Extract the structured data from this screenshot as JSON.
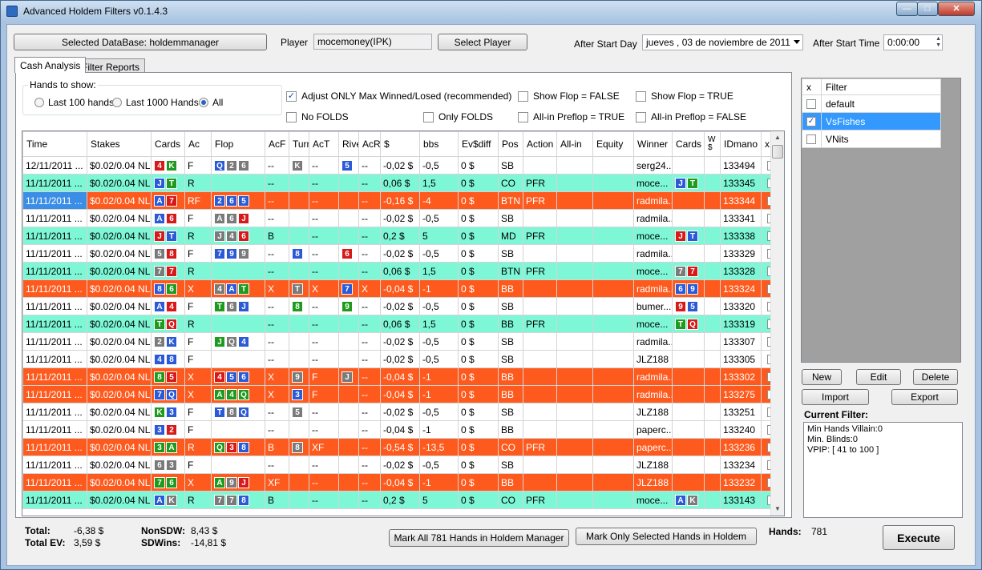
{
  "window": {
    "title": "Advanced Holdem Filters v0.1.4.3"
  },
  "top": {
    "db_button": "Selected DataBase: holdemmanager",
    "player_label": "Player",
    "player_value": "mocemoney(IPK)",
    "select_player": "Select Player",
    "after_start_day_label": "After Start Day",
    "after_start_day_value": "jueves  , 03 de noviembre de 2011",
    "after_start_time_label": "After Start Time",
    "after_start_time_value": "0:00:00"
  },
  "tabs": [
    {
      "label": "Cash Analysis"
    },
    {
      "label": "Filter Reports"
    }
  ],
  "hands_group": {
    "title": "Hands to show:",
    "options": [
      "Last 100 hands",
      "Last 1000 Hands",
      "All"
    ],
    "selected": "All"
  },
  "options": {
    "adjust": "Adjust ONLY Max Winned/Losed (recommended)",
    "no_folds": "No FOLDS",
    "only_folds": "Only FOLDS",
    "show_flop_false": "Show Flop = FALSE",
    "show_flop_true": "Show Flop = TRUE",
    "allin_true": "All-in Preflop = TRUE",
    "allin_false": "All-in Preflop = FALSE"
  },
  "grid": {
    "columns": [
      "Time",
      "Stakes",
      "Cards",
      "Ac",
      "Flop",
      "AcF",
      "Turn",
      "AcT",
      "Rive",
      "AcR",
      "$",
      "bbs",
      "Ev$diff",
      "Pos",
      "Action",
      "All-in",
      "Equity",
      "Winner",
      "Cards",
      "W $",
      "IDmano",
      "x"
    ],
    "rows": [
      {
        "c": "white",
        "time": "12/11/2011 ...",
        "stakes": "$0.02/0.04 NL",
        "cards": [
          [
            "4",
            "r"
          ],
          [
            "K",
            "g"
          ]
        ],
        "ac": "F",
        "flop": [
          [
            "Q",
            "b"
          ],
          [
            "2",
            "k"
          ],
          [
            "6",
            "k"
          ]
        ],
        "acf": "--",
        "turn": [
          [
            "K",
            "k"
          ]
        ],
        "act": "--",
        "river": [
          [
            "5",
            "b"
          ]
        ],
        "acr": "--",
        "usd": "-0,02 $",
        "bbs": "-0,5",
        "ev": "0 $",
        "pos": "SB",
        "action": "",
        "allin": "",
        "equity": "",
        "winner": "serg24...",
        "wcards": [],
        "wd": "",
        "id": "133494"
      },
      {
        "c": "green",
        "time": "11/11/2011 ...",
        "stakes": "$0.02/0.04 NL",
        "cards": [
          [
            "J",
            "b"
          ],
          [
            "T",
            "g"
          ]
        ],
        "ac": "R",
        "flop": [],
        "acf": "--",
        "turn": [],
        "act": "--",
        "river": [],
        "acr": "--",
        "usd": "0,06 $",
        "bbs": "1,5",
        "ev": "0 $",
        "pos": "CO",
        "action": "PFR",
        "allin": "",
        "equity": "",
        "winner": "moce...",
        "wcards": [
          [
            "J",
            "b"
          ],
          [
            "T",
            "g"
          ]
        ],
        "wd": "",
        "id": "133345"
      },
      {
        "c": "red",
        "sel": true,
        "time": "11/11/2011 ...",
        "stakes": "$0.02/0.04 NL",
        "cards": [
          [
            "A",
            "b"
          ],
          [
            "7",
            "r"
          ]
        ],
        "ac": "RF",
        "flop": [
          [
            "2",
            "b"
          ],
          [
            "6",
            "b"
          ],
          [
            "5",
            "b"
          ]
        ],
        "acf": "--",
        "turn": [],
        "act": "--",
        "river": [],
        "acr": "--",
        "usd": "-0,16 $",
        "bbs": "-4",
        "ev": "0 $",
        "pos": "BTN",
        "action": "PFR",
        "allin": "",
        "equity": "",
        "winner": "radmila...",
        "wcards": [],
        "wd": "",
        "id": "133344"
      },
      {
        "c": "white",
        "time": "11/11/2011 ...",
        "stakes": "$0.02/0.04 NL",
        "cards": [
          [
            "A",
            "b"
          ],
          [
            "6",
            "r"
          ]
        ],
        "ac": "F",
        "flop": [
          [
            "A",
            "k"
          ],
          [
            "6",
            "k"
          ],
          [
            "J",
            "r"
          ]
        ],
        "acf": "--",
        "turn": [],
        "act": "--",
        "river": [],
        "acr": "--",
        "usd": "-0,02 $",
        "bbs": "-0,5",
        "ev": "0 $",
        "pos": "SB",
        "action": "",
        "allin": "",
        "equity": "",
        "winner": "radmila...",
        "wcards": [],
        "wd": "",
        "id": "133341"
      },
      {
        "c": "green",
        "time": "11/11/2011 ...",
        "stakes": "$0.02/0.04 NL",
        "cards": [
          [
            "J",
            "r"
          ],
          [
            "T",
            "b"
          ]
        ],
        "ac": "R",
        "flop": [
          [
            "J",
            "k"
          ],
          [
            "4",
            "k"
          ],
          [
            "6",
            "r"
          ]
        ],
        "acf": "B",
        "turn": [],
        "act": "--",
        "river": [],
        "acr": "--",
        "usd": "0,2 $",
        "bbs": "5",
        "ev": "0 $",
        "pos": "MD",
        "action": "PFR",
        "allin": "",
        "equity": "",
        "winner": "moce...",
        "wcards": [
          [
            "J",
            "r"
          ],
          [
            "T",
            "b"
          ]
        ],
        "wd": "",
        "id": "133338"
      },
      {
        "c": "white",
        "time": "11/11/2011 ...",
        "stakes": "$0.02/0.04 NL",
        "cards": [
          [
            "5",
            "k"
          ],
          [
            "8",
            "r"
          ]
        ],
        "ac": "F",
        "flop": [
          [
            "7",
            "b"
          ],
          [
            "9",
            "b"
          ],
          [
            "9",
            "k"
          ]
        ],
        "acf": "--",
        "turn": [
          [
            "8",
            "b"
          ]
        ],
        "act": "--",
        "river": [
          [
            "6",
            "r"
          ]
        ],
        "acr": "--",
        "usd": "-0,02 $",
        "bbs": "-0,5",
        "ev": "0 $",
        "pos": "SB",
        "action": "",
        "allin": "",
        "equity": "",
        "winner": "radmila...",
        "wcards": [],
        "wd": "",
        "id": "133329"
      },
      {
        "c": "green",
        "time": "11/11/2011 ...",
        "stakes": "$0.02/0.04 NL",
        "cards": [
          [
            "7",
            "k"
          ],
          [
            "7",
            "r"
          ]
        ],
        "ac": "R",
        "flop": [],
        "acf": "--",
        "turn": [],
        "act": "--",
        "river": [],
        "acr": "--",
        "usd": "0,06 $",
        "bbs": "1,5",
        "ev": "0 $",
        "pos": "BTN",
        "action": "PFR",
        "allin": "",
        "equity": "",
        "winner": "moce...",
        "wcards": [
          [
            "7",
            "k"
          ],
          [
            "7",
            "r"
          ]
        ],
        "wd": "",
        "id": "133328"
      },
      {
        "c": "red",
        "time": "11/11/2011 ...",
        "stakes": "$0.02/0.04 NL",
        "cards": [
          [
            "8",
            "b"
          ],
          [
            "6",
            "g"
          ]
        ],
        "ac": "X",
        "flop": [
          [
            "4",
            "k"
          ],
          [
            "A",
            "b"
          ],
          [
            "T",
            "g"
          ]
        ],
        "acf": "X",
        "turn": [
          [
            "T",
            "k"
          ]
        ],
        "act": "X",
        "river": [
          [
            "7",
            "b"
          ]
        ],
        "acr": "X",
        "usd": "-0,04 $",
        "bbs": "-1",
        "ev": "0 $",
        "pos": "BB",
        "action": "",
        "allin": "",
        "equity": "",
        "winner": "radmila...",
        "wcards": [
          [
            "6",
            "b"
          ],
          [
            "9",
            "b"
          ]
        ],
        "wd": "",
        "id": "133324"
      },
      {
        "c": "white",
        "time": "11/11/2011 ...",
        "stakes": "$0.02/0.04 NL",
        "cards": [
          [
            "A",
            "b"
          ],
          [
            "4",
            "r"
          ]
        ],
        "ac": "F",
        "flop": [
          [
            "T",
            "g"
          ],
          [
            "6",
            "k"
          ],
          [
            "J",
            "b"
          ]
        ],
        "acf": "--",
        "turn": [
          [
            "8",
            "g"
          ]
        ],
        "act": "--",
        "river": [
          [
            "9",
            "g"
          ]
        ],
        "acr": "--",
        "usd": "-0,02 $",
        "bbs": "-0,5",
        "ev": "0 $",
        "pos": "SB",
        "action": "",
        "allin": "",
        "equity": "",
        "winner": "bumer...",
        "wcards": [
          [
            "9",
            "r"
          ],
          [
            "5",
            "b"
          ]
        ],
        "wd": "",
        "id": "133320"
      },
      {
        "c": "green",
        "time": "11/11/2011 ...",
        "stakes": "$0.02/0.04 NL",
        "cards": [
          [
            "T",
            "g"
          ],
          [
            "Q",
            "r"
          ]
        ],
        "ac": "R",
        "flop": [],
        "acf": "--",
        "turn": [],
        "act": "--",
        "river": [],
        "acr": "--",
        "usd": "0,06 $",
        "bbs": "1,5",
        "ev": "0 $",
        "pos": "BB",
        "action": "PFR",
        "allin": "",
        "equity": "",
        "winner": "moce...",
        "wcards": [
          [
            "T",
            "g"
          ],
          [
            "Q",
            "r"
          ]
        ],
        "wd": "",
        "id": "133319"
      },
      {
        "c": "white",
        "time": "11/11/2011 ...",
        "stakes": "$0.02/0.04 NL",
        "cards": [
          [
            "2",
            "k"
          ],
          [
            "K",
            "b"
          ]
        ],
        "ac": "F",
        "flop": [
          [
            "J",
            "g"
          ],
          [
            "Q",
            "k"
          ],
          [
            "4",
            "b"
          ]
        ],
        "acf": "--",
        "turn": [],
        "act": "--",
        "river": [],
        "acr": "--",
        "usd": "-0,02 $",
        "bbs": "-0,5",
        "ev": "0 $",
        "pos": "SB",
        "action": "",
        "allin": "",
        "equity": "",
        "winner": "radmila...",
        "wcards": [],
        "wd": "",
        "id": "133307"
      },
      {
        "c": "white",
        "time": "11/11/2011 ...",
        "stakes": "$0.02/0.04 NL",
        "cards": [
          [
            "4",
            "b"
          ],
          [
            "8",
            "b"
          ]
        ],
        "ac": "F",
        "flop": [],
        "acf": "--",
        "turn": [],
        "act": "--",
        "river": [],
        "acr": "--",
        "usd": "-0,02 $",
        "bbs": "-0,5",
        "ev": "0 $",
        "pos": "SB",
        "action": "",
        "allin": "",
        "equity": "",
        "winner": "JLZ188",
        "wcards": [],
        "wd": "",
        "id": "133305"
      },
      {
        "c": "red",
        "time": "11/11/2011 ...",
        "stakes": "$0.02/0.04 NL",
        "cards": [
          [
            "8",
            "g"
          ],
          [
            "5",
            "r"
          ]
        ],
        "ac": "X",
        "flop": [
          [
            "4",
            "r"
          ],
          [
            "5",
            "b"
          ],
          [
            "6",
            "b"
          ]
        ],
        "acf": "X",
        "turn": [
          [
            "9",
            "k"
          ]
        ],
        "act": "F",
        "river": [
          [
            "J",
            "k"
          ]
        ],
        "acr": "--",
        "usd": "-0,04 $",
        "bbs": "-1",
        "ev": "0 $",
        "pos": "BB",
        "action": "",
        "allin": "",
        "equity": "",
        "winner": "radmila...",
        "wcards": [],
        "wd": "",
        "id": "133302"
      },
      {
        "c": "red",
        "time": "11/11/2011 ...",
        "stakes": "$0.02/0.04 NL",
        "cards": [
          [
            "7",
            "b"
          ],
          [
            "Q",
            "b"
          ]
        ],
        "ac": "X",
        "flop": [
          [
            "A",
            "g"
          ],
          [
            "4",
            "g"
          ],
          [
            "Q",
            "g"
          ]
        ],
        "acf": "X",
        "turn": [
          [
            "3",
            "b"
          ]
        ],
        "act": "F",
        "river": [],
        "acr": "--",
        "usd": "-0,04 $",
        "bbs": "-1",
        "ev": "0 $",
        "pos": "BB",
        "action": "",
        "allin": "",
        "equity": "",
        "winner": "radmila...",
        "wcards": [],
        "wd": "",
        "id": "133275"
      },
      {
        "c": "white",
        "time": "11/11/2011 ...",
        "stakes": "$0.02/0.04 NL",
        "cards": [
          [
            "K",
            "g"
          ],
          [
            "3",
            "b"
          ]
        ],
        "ac": "F",
        "flop": [
          [
            "T",
            "b"
          ],
          [
            "8",
            "k"
          ],
          [
            "Q",
            "b"
          ]
        ],
        "acf": "--",
        "turn": [
          [
            "5",
            "k"
          ]
        ],
        "act": "--",
        "river": [],
        "acr": "--",
        "usd": "-0,02 $",
        "bbs": "-0,5",
        "ev": "0 $",
        "pos": "SB",
        "action": "",
        "allin": "",
        "equity": "",
        "winner": "JLZ188",
        "wcards": [],
        "wd": "",
        "id": "133251"
      },
      {
        "c": "white",
        "time": "11/11/2011 ...",
        "stakes": "$0.02/0.04 NL",
        "cards": [
          [
            "3",
            "b"
          ],
          [
            "2",
            "r"
          ]
        ],
        "ac": "F",
        "flop": [],
        "acf": "--",
        "turn": [],
        "act": "--",
        "river": [],
        "acr": "--",
        "usd": "-0,04 $",
        "bbs": "-1",
        "ev": "0 $",
        "pos": "BB",
        "action": "",
        "allin": "",
        "equity": "",
        "winner": "paperc...",
        "wcards": [],
        "wd": "",
        "id": "133240"
      },
      {
        "c": "red",
        "time": "11/11/2011 ...",
        "stakes": "$0.02/0.04 NL",
        "cards": [
          [
            "3",
            "g"
          ],
          [
            "A",
            "g"
          ]
        ],
        "ac": "R",
        "flop": [
          [
            "Q",
            "g"
          ],
          [
            "3",
            "r"
          ],
          [
            "8",
            "b"
          ]
        ],
        "acf": "B",
        "turn": [
          [
            "8",
            "k"
          ]
        ],
        "act": "XF",
        "river": [],
        "acr": "--",
        "usd": "-0,54 $",
        "bbs": "-13,5",
        "ev": "0 $",
        "pos": "CO",
        "action": "PFR",
        "allin": "",
        "equity": "",
        "winner": "paperc...",
        "wcards": [],
        "wd": "",
        "id": "133236"
      },
      {
        "c": "white",
        "time": "11/11/2011 ...",
        "stakes": "$0.02/0.04 NL",
        "cards": [
          [
            "6",
            "k"
          ],
          [
            "3",
            "k"
          ]
        ],
        "ac": "F",
        "flop": [],
        "acf": "--",
        "turn": [],
        "act": "--",
        "river": [],
        "acr": "--",
        "usd": "-0,02 $",
        "bbs": "-0,5",
        "ev": "0 $",
        "pos": "SB",
        "action": "",
        "allin": "",
        "equity": "",
        "winner": "JLZ188",
        "wcards": [],
        "wd": "",
        "id": "133234"
      },
      {
        "c": "red",
        "time": "11/11/2011 ...",
        "stakes": "$0.02/0.04 NL",
        "cards": [
          [
            "7",
            "g"
          ],
          [
            "6",
            "g"
          ]
        ],
        "ac": "X",
        "flop": [
          [
            "A",
            "g"
          ],
          [
            "9",
            "k"
          ],
          [
            "J",
            "r"
          ]
        ],
        "acf": "XF",
        "turn": [],
        "act": "--",
        "river": [],
        "acr": "--",
        "usd": "-0,04 $",
        "bbs": "-1",
        "ev": "0 $",
        "pos": "BB",
        "action": "",
        "allin": "",
        "equity": "",
        "winner": "JLZ188",
        "wcards": [],
        "wd": "",
        "id": "133232"
      },
      {
        "c": "green",
        "time": "11/11/2011 ...",
        "stakes": "$0.02/0.04 NL",
        "cards": [
          [
            "A",
            "b"
          ],
          [
            "K",
            "k"
          ]
        ],
        "ac": "R",
        "flop": [
          [
            "7",
            "k"
          ],
          [
            "7",
            "k"
          ],
          [
            "8",
            "b"
          ]
        ],
        "acf": "B",
        "turn": [],
        "act": "--",
        "river": [],
        "acr": "--",
        "usd": "0,2 $",
        "bbs": "5",
        "ev": "0 $",
        "pos": "CO",
        "action": "PFR",
        "allin": "",
        "equity": "",
        "winner": "moce...",
        "wcards": [
          [
            "A",
            "b"
          ],
          [
            "K",
            "k"
          ]
        ],
        "wd": "",
        "id": "133143"
      }
    ]
  },
  "filters": {
    "headers": [
      "x",
      "Filter"
    ],
    "items": [
      {
        "name": "default",
        "checked": false,
        "selected": false
      },
      {
        "name": "VsFishes",
        "checked": true,
        "selected": true
      },
      {
        "name": "VNits",
        "checked": false,
        "selected": false
      }
    ],
    "new": "New",
    "edit": "Edit",
    "delete": "Delete",
    "import": "Import",
    "export": "Export",
    "current_label": "Current Filter:",
    "current_lines": [
      "Min Hands Villain:0",
      "Min. Blinds:0",
      "VPIP: [ 41 to 100 ]"
    ]
  },
  "totals": {
    "total_label": "Total:",
    "total_value": "-6,38 $",
    "total_ev_label": "Total EV:",
    "total_ev_value": "3,59 $",
    "nonsdw_label": "NonSDW:",
    "nonsdw_value": "8,43 $",
    "sdwins_label": "SDWins:",
    "sdwins_value": "-14,81 $"
  },
  "bottom": {
    "mark_all": "Mark All 781 Hands in Holdem Manager",
    "mark_selected": "Mark Only Selected Hands in Holdem",
    "hands_label": "Hands:",
    "hands_value": "781",
    "execute": "Execute"
  }
}
